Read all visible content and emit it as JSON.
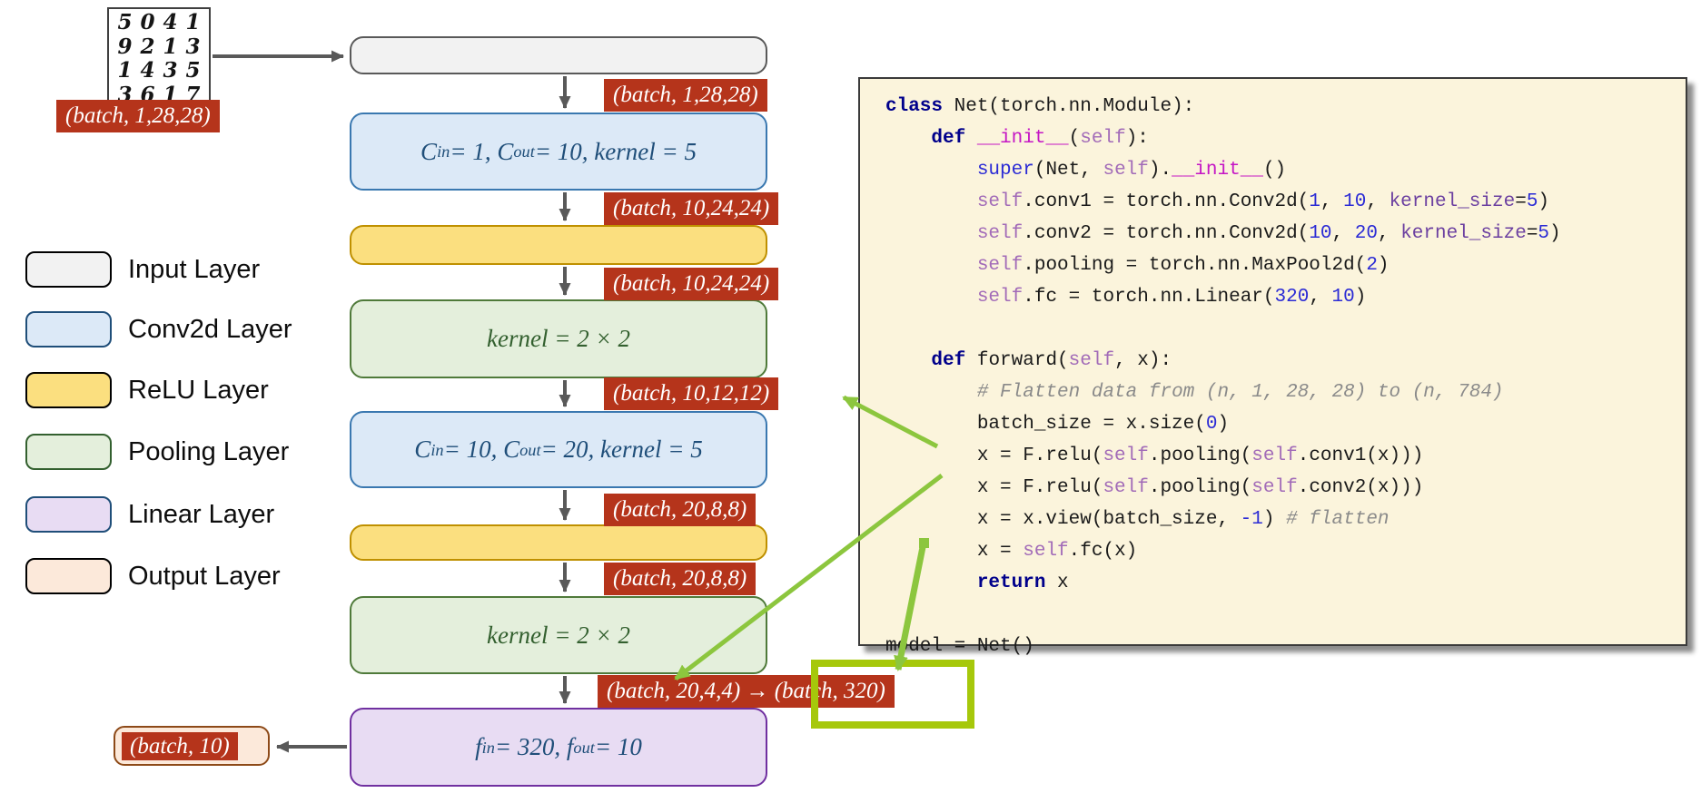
{
  "colors": {
    "badge_red": "#B5341B",
    "gray_arrow": "#595959",
    "green_arrow": "#8CC63E",
    "green_highlight_box": "#A6C80B",
    "code_background": "#FBF4DC"
  },
  "mnist": {
    "rows": [
      "5041",
      "9213",
      "1435",
      "3617"
    ],
    "badge": "(batch, 1,28,28)"
  },
  "legend": {
    "items": [
      {
        "type": "input",
        "label": "Input Layer"
      },
      {
        "type": "conv",
        "label": "Conv2d Layer"
      },
      {
        "type": "relu",
        "label": "ReLU Layer"
      },
      {
        "type": "pool",
        "label": "Pooling Layer"
      },
      {
        "type": "linear",
        "label": "Linear Layer"
      },
      {
        "type": "output",
        "label": "Output Layer"
      }
    ]
  },
  "flow": {
    "boxes": [
      {
        "type": "input",
        "label": ""
      },
      {
        "type": "conv",
        "label": "C_{in} = 1, C_{out} = 10, kernel = 5"
      },
      {
        "type": "relu",
        "label": ""
      },
      {
        "type": "pool",
        "label": "kernel = 2 × 2"
      },
      {
        "type": "conv",
        "label": "C_{in} = 10, C_{out} = 20, kernel = 5"
      },
      {
        "type": "relu",
        "label": ""
      },
      {
        "type": "pool",
        "label": "kernel = 2 × 2"
      },
      {
        "type": "linear",
        "label": "f_{in} = 320, f_{out} = 10"
      }
    ],
    "badges": [
      "(batch, 1,28,28)",
      "(batch, 10,24,24)",
      "(batch, 10,24,24)",
      "(batch, 10,12,12)",
      "(batch, 20,8,8)",
      "(batch, 20,8,8)",
      "(batch, 20,4,4) → (batch, 320)"
    ],
    "output_badge": "(batch, 10)"
  },
  "code": {
    "lines": [
      [
        [
          "kw",
          "class "
        ],
        [
          "t",
          "Net(torch.nn.Module):"
        ]
      ],
      [
        [
          "t",
          "    "
        ],
        [
          "kw",
          "def "
        ],
        [
          "m",
          "__init__"
        ],
        [
          "t",
          "("
        ],
        [
          "s",
          "self"
        ],
        [
          "t",
          "):"
        ]
      ],
      [
        [
          "t",
          "        "
        ],
        [
          "b",
          "super"
        ],
        [
          "t",
          "(Net, "
        ],
        [
          "s",
          "self"
        ],
        [
          "t",
          ")."
        ],
        [
          "m",
          "__init__"
        ],
        [
          "t",
          "()"
        ]
      ],
      [
        [
          "t",
          "        "
        ],
        [
          "s",
          "self"
        ],
        [
          "t",
          ".conv1 = torch.nn.Conv2d("
        ],
        [
          "b",
          "1"
        ],
        [
          "t",
          ", "
        ],
        [
          "b",
          "10"
        ],
        [
          "t",
          ", "
        ],
        [
          "p",
          "kernel_size"
        ],
        [
          "t",
          "="
        ],
        [
          "b",
          "5"
        ],
        [
          "t",
          ")"
        ]
      ],
      [
        [
          "t",
          "        "
        ],
        [
          "s",
          "self"
        ],
        [
          "t",
          ".conv2 = torch.nn.Conv2d("
        ],
        [
          "b",
          "10"
        ],
        [
          "t",
          ", "
        ],
        [
          "b",
          "20"
        ],
        [
          "t",
          ", "
        ],
        [
          "p",
          "kernel_size"
        ],
        [
          "t",
          "="
        ],
        [
          "b",
          "5"
        ],
        [
          "t",
          ")"
        ]
      ],
      [
        [
          "t",
          "        "
        ],
        [
          "s",
          "self"
        ],
        [
          "t",
          ".pooling = torch.nn.MaxPool2d("
        ],
        [
          "b",
          "2"
        ],
        [
          "t",
          ")"
        ]
      ],
      [
        [
          "t",
          "        "
        ],
        [
          "s",
          "self"
        ],
        [
          "t",
          ".fc = torch.nn.Linear("
        ],
        [
          "b",
          "320"
        ],
        [
          "t",
          ", "
        ],
        [
          "b",
          "10"
        ],
        [
          "t",
          ")"
        ]
      ],
      [],
      [
        [
          "t",
          "    "
        ],
        [
          "kw",
          "def "
        ],
        [
          "t",
          "forward("
        ],
        [
          "s",
          "self"
        ],
        [
          "t",
          ", x):"
        ]
      ],
      [
        [
          "t",
          "        "
        ],
        [
          "c",
          "# Flatten data from (n, 1, 28, 28) to (n, 784)"
        ]
      ],
      [
        [
          "t",
          "        batch_size = x.size("
        ],
        [
          "b",
          "0"
        ],
        [
          "t",
          ")"
        ]
      ],
      [
        [
          "t",
          "        x = F.relu("
        ],
        [
          "s",
          "self"
        ],
        [
          "t",
          ".pooling("
        ],
        [
          "s",
          "self"
        ],
        [
          "t",
          ".conv1(x)))"
        ]
      ],
      [
        [
          "t",
          "        x = F.relu("
        ],
        [
          "s",
          "self"
        ],
        [
          "t",
          ".pooling("
        ],
        [
          "s",
          "self"
        ],
        [
          "t",
          ".conv2(x)))"
        ]
      ],
      [
        [
          "t",
          "        x = x.view(batch_size, "
        ],
        [
          "b",
          "-1"
        ],
        [
          "t",
          ") "
        ],
        [
          "c",
          "# flatten"
        ]
      ],
      [
        [
          "t",
          "        x = "
        ],
        [
          "s",
          "self"
        ],
        [
          "t",
          ".fc(x)"
        ]
      ],
      [
        [
          "t",
          "        "
        ],
        [
          "kw",
          "return"
        ],
        [
          "t",
          " x"
        ]
      ],
      [],
      [
        [
          "t",
          "model = Net()"
        ]
      ]
    ]
  }
}
